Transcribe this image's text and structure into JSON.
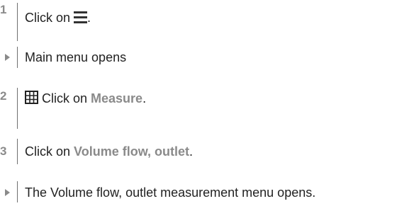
{
  "steps": [
    {
      "marker": "1",
      "text_before": "Click on ",
      "icon": "hamburger-menu-icon",
      "text_after": "."
    },
    {
      "marker": "arrow",
      "text": "Main menu opens"
    },
    {
      "marker": "2",
      "icon": "grid-icon",
      "text_before": " Click on ",
      "keyword": "Measure",
      "text_after": "."
    },
    {
      "marker": "3",
      "text_before": "Click on ",
      "keyword": "Volume flow, outlet",
      "text_after": "."
    },
    {
      "marker": "arrow",
      "text": "The Volume flow, outlet measurement menu opens."
    }
  ]
}
